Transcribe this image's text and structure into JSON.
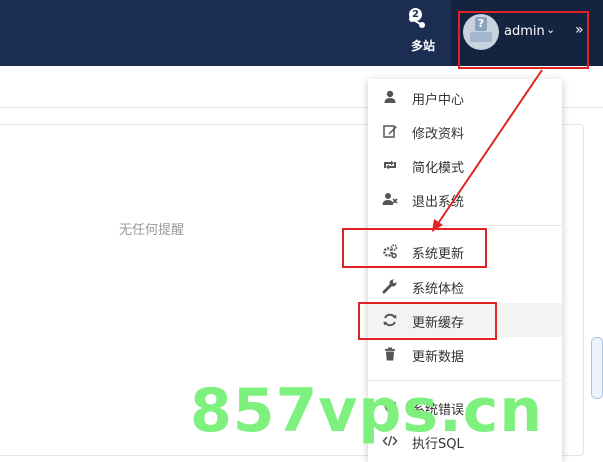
{
  "header": {
    "sites_label": "多站",
    "sites_badge": "2",
    "username": "admin",
    "caret": "⌄",
    "expand": "»"
  },
  "main": {
    "empty_text": "无任何提醒"
  },
  "dropdown": {
    "items": [
      {
        "label": "用户中心",
        "icon": "user-icon"
      },
      {
        "label": "修改资料",
        "icon": "edit-icon"
      },
      {
        "label": "简化模式",
        "icon": "retweet-icon"
      },
      {
        "label": "退出系统",
        "icon": "user-remove-icon"
      },
      {
        "label": "系统更新",
        "icon": "gears-icon"
      },
      {
        "label": "系统体检",
        "icon": "wrench-icon"
      },
      {
        "label": "更新缓存",
        "icon": "refresh-icon"
      },
      {
        "label": "更新数据",
        "icon": "trash-icon"
      },
      {
        "label": "系统错误",
        "icon": "shield-icon"
      },
      {
        "label": "执行SQL",
        "icon": "code-icon"
      }
    ]
  },
  "watermark": "857vps.cn",
  "colors": {
    "header_bg": "#1b2e52",
    "highlight": "#e02424",
    "watermark": "#7ef07e"
  }
}
